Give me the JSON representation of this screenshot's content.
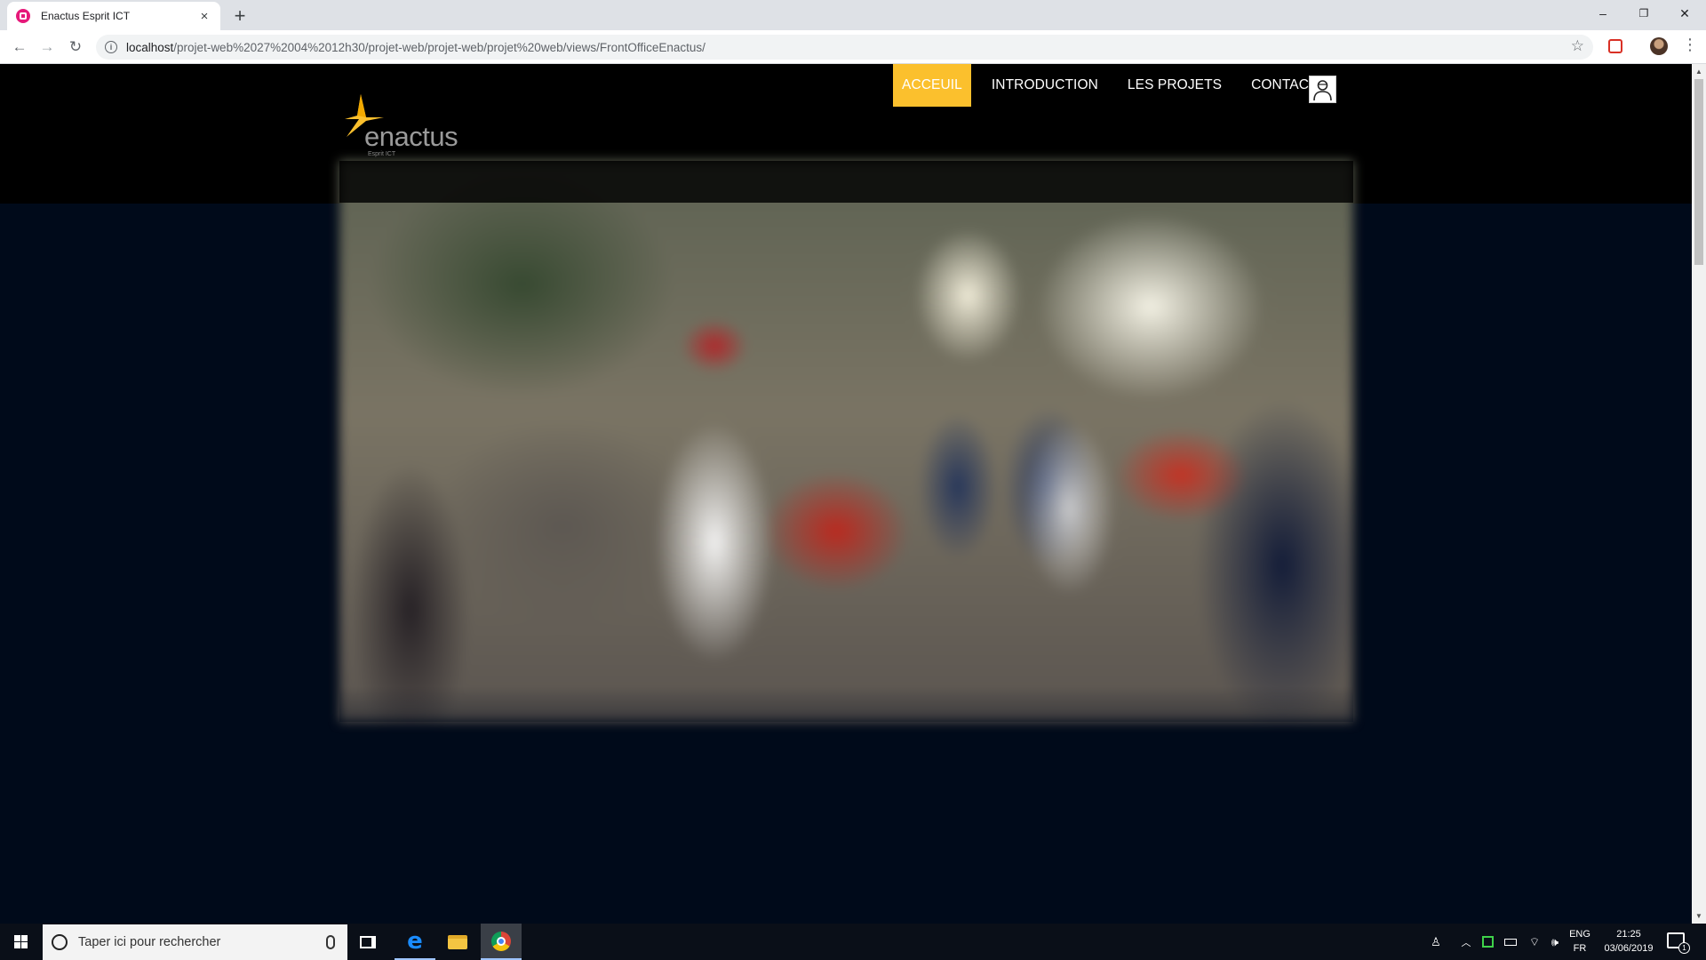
{
  "browser": {
    "tab_title": "Enactus Esprit ICT",
    "tab_close": "×",
    "new_tab": "+",
    "url_host": "localhost",
    "url_path": "/projet-web%2027%2004%2012h30/projet-web/projet-web/projet%20web/views/FrontOfficeEnactus/",
    "back_glyph": "←",
    "forward_glyph": "→",
    "reload_glyph": "↻",
    "star_glyph": "☆",
    "menu_glyph": "⋮",
    "window": {
      "minimize": "–",
      "restore": "❐",
      "close": "✕"
    },
    "icons": [
      "favicon-icon",
      "back-icon",
      "forward-icon",
      "reload-icon",
      "info-icon",
      "star-icon",
      "extension-icon",
      "profile-icon",
      "menu-icon"
    ]
  },
  "site": {
    "logo_text": "enactus",
    "logo_sub": "Esprit ICT",
    "accent_color": "#fbc02d",
    "nav": [
      {
        "label": "ACCEUIL",
        "active": true
      },
      {
        "label": "INTRODUCTION",
        "active": false
      },
      {
        "label": "LES PROJETS",
        "active": false
      },
      {
        "label": "CONTACT",
        "active": false
      }
    ],
    "user_icon": "user-avatar-icon",
    "hero_image": "blurred-group-photo"
  },
  "taskbar": {
    "search_placeholder": "Taper ici pour rechercher",
    "apps": [
      "task-view-icon",
      "edge-icon",
      "file-explorer-icon",
      "chrome-icon"
    ],
    "tray": {
      "lang_top": "ENG",
      "lang_bottom": "FR",
      "time": "21:25",
      "date": "03/06/2019",
      "notification_count": "1"
    }
  }
}
